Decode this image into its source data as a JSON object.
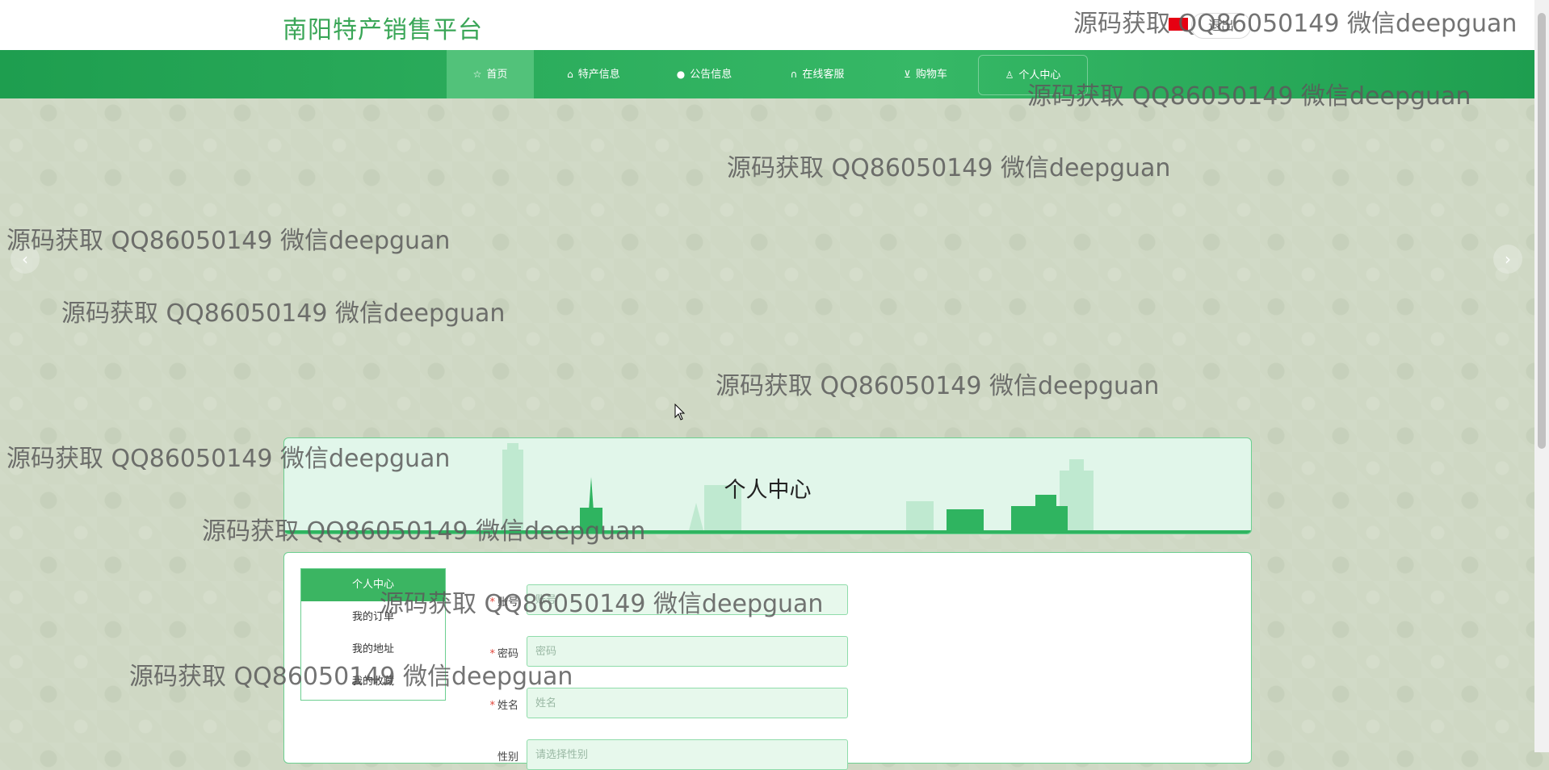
{
  "header": {
    "site_title": "南阳特产销售平台",
    "logout_label": "退出"
  },
  "nav": {
    "items": [
      {
        "icon": "star-icon",
        "glyph": "☆",
        "label": "首页",
        "active": true
      },
      {
        "icon": "shopping-bag-icon",
        "glyph": "⌂",
        "label": "特产信息",
        "active": false
      },
      {
        "icon": "info-circle-icon",
        "glyph": "●",
        "label": "公告信息",
        "active": false
      },
      {
        "icon": "headset-icon",
        "glyph": "∩",
        "label": "在线客服",
        "active": false
      },
      {
        "icon": "cart-icon",
        "glyph": "⊻",
        "label": "购物车",
        "active": false
      },
      {
        "icon": "user-icon",
        "glyph": "♙",
        "label": "个人中心",
        "active": false
      }
    ]
  },
  "carousel": {
    "prev_glyph": "‹",
    "next_glyph": "›"
  },
  "banner": {
    "title": "个人中心"
  },
  "sidebar": {
    "items": [
      {
        "label": "个人中心",
        "active": true
      },
      {
        "label": "我的订单",
        "active": false
      },
      {
        "label": "我的地址",
        "active": false
      },
      {
        "label": "我的收藏",
        "active": false
      }
    ]
  },
  "form": {
    "fields": [
      {
        "label": "账号",
        "required": true,
        "placeholder": "账号"
      },
      {
        "label": "密码",
        "required": true,
        "placeholder": "密码"
      },
      {
        "label": "姓名",
        "required": true,
        "placeholder": "姓名"
      },
      {
        "label": "性别",
        "required": false,
        "placeholder": "请选择性别"
      }
    ]
  },
  "watermark": {
    "text": "源码获取 QQ86050149 微信deepguan"
  },
  "colors": {
    "brand_green": "#3aa657",
    "nav_green": "#1e9e4f",
    "active_green": "#3bb562",
    "required_red": "#e0453a"
  }
}
